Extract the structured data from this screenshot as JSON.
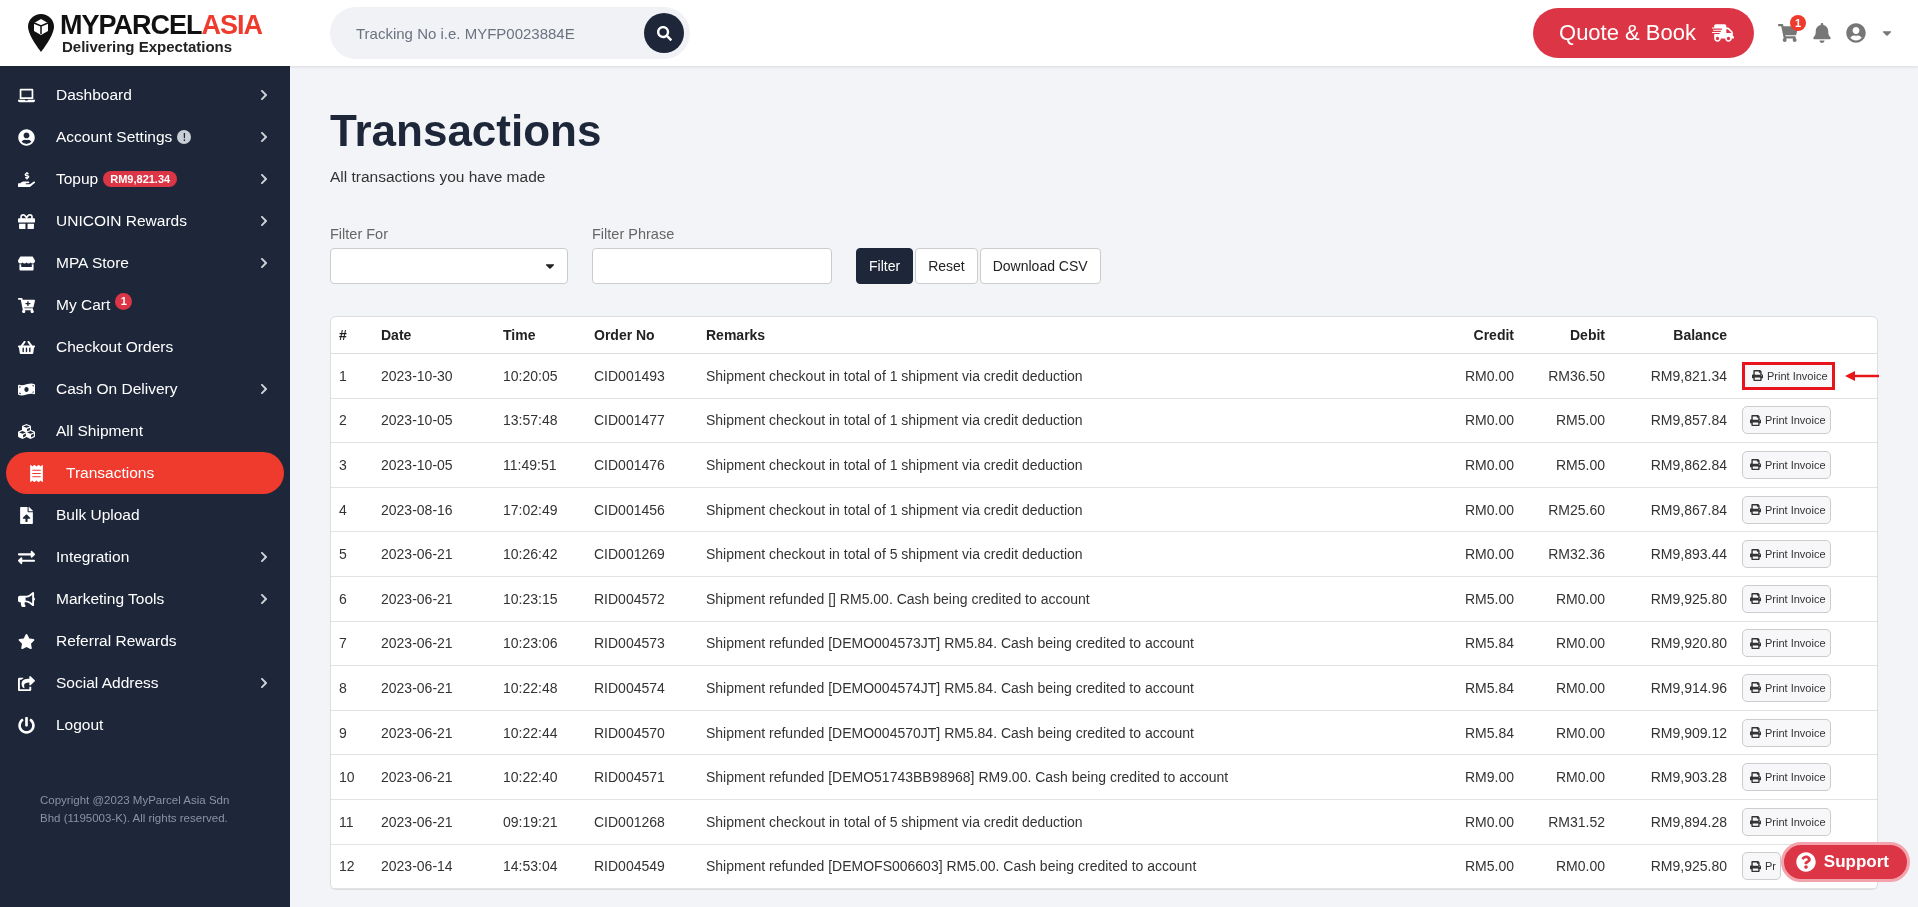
{
  "header": {
    "logo": {
      "brand": "MYPARCEL",
      "brand_accent": "ASIA",
      "tagline": "Delivering Expectations"
    },
    "search": {
      "placeholder": "Tracking No i.e. MYFP0023884E"
    },
    "quote_button": "Quote & Book",
    "cart_badge": "1"
  },
  "sidebar": {
    "items": [
      {
        "label": "Dashboard",
        "has_submenu": true,
        "selected": false
      },
      {
        "label": "Account Settings",
        "badge": {
          "kind": "info",
          "text": "!"
        },
        "has_submenu": true,
        "selected": false
      },
      {
        "label": "Topup",
        "badge": {
          "kind": "amount",
          "text": "RM9,821.34"
        },
        "has_submenu": true,
        "selected": false
      },
      {
        "label": "UNICOIN Rewards",
        "has_submenu": true,
        "selected": false
      },
      {
        "label": "MPA Store",
        "has_submenu": true,
        "selected": false
      },
      {
        "label": "My Cart",
        "badge": {
          "kind": "count",
          "text": "1"
        },
        "has_submenu": false,
        "selected": false
      },
      {
        "label": "Checkout Orders",
        "has_submenu": false,
        "selected": false
      },
      {
        "label": "Cash On Delivery",
        "has_submenu": true,
        "selected": false
      },
      {
        "label": "All Shipment",
        "has_submenu": false,
        "selected": false
      },
      {
        "label": "Transactions",
        "has_submenu": false,
        "selected": true
      },
      {
        "label": "Bulk Upload",
        "has_submenu": false,
        "selected": false
      },
      {
        "label": "Integration",
        "has_submenu": true,
        "selected": false
      },
      {
        "label": "Marketing Tools",
        "has_submenu": true,
        "selected": false
      },
      {
        "label": "Referral Rewards",
        "has_submenu": false,
        "selected": false
      },
      {
        "label": "Social Address",
        "has_submenu": true,
        "selected": false
      },
      {
        "label": "Logout",
        "has_submenu": false,
        "selected": false
      }
    ],
    "copyright": "Copyright @2023 MyParcel Asia Sdn Bhd (1195003-K). All rights reserved."
  },
  "page": {
    "title": "Transactions",
    "subtitle": "All transactions you have made"
  },
  "filters": {
    "filter_for": {
      "label": "Filter For"
    },
    "filter_phrase": {
      "label": "Filter Phrase"
    },
    "buttons": [
      {
        "label": "Filter",
        "kind": "primary"
      },
      {
        "label": "Reset",
        "kind": "default"
      },
      {
        "label": "Download CSV",
        "kind": "default"
      }
    ]
  },
  "table": {
    "columns": [
      "#",
      "Date",
      "Time",
      "Order No",
      "Remarks",
      "Credit",
      "Debit",
      "Balance"
    ],
    "rows": [
      {
        "no": "1",
        "date": "2023-10-30",
        "time": "10:20:05",
        "order": "CID001493",
        "remarks": "Shipment checkout in total of 1 shipment via credit deduction",
        "credit": "RM0.00",
        "debit": "RM36.50",
        "balance": "RM9,821.34",
        "action": "Print Invoice",
        "highlighted": true
      },
      {
        "no": "2",
        "date": "2023-10-05",
        "time": "13:57:48",
        "order": "CID001477",
        "remarks": "Shipment checkout in total of 1 shipment via credit deduction",
        "credit": "RM0.00",
        "debit": "RM5.00",
        "balance": "RM9,857.84",
        "action": "Print Invoice",
        "highlighted": false
      },
      {
        "no": "3",
        "date": "2023-10-05",
        "time": "11:49:51",
        "order": "CID001476",
        "remarks": "Shipment checkout in total of 1 shipment via credit deduction",
        "credit": "RM0.00",
        "debit": "RM5.00",
        "balance": "RM9,862.84",
        "action": "Print Invoice",
        "highlighted": false
      },
      {
        "no": "4",
        "date": "2023-08-16",
        "time": "17:02:49",
        "order": "CID001456",
        "remarks": "Shipment checkout in total of 1 shipment via credit deduction",
        "credit": "RM0.00",
        "debit": "RM25.60",
        "balance": "RM9,867.84",
        "action": "Print Invoice",
        "highlighted": false
      },
      {
        "no": "5",
        "date": "2023-06-21",
        "time": "10:26:42",
        "order": "CID001269",
        "remarks": "Shipment checkout in total of 5 shipment via credit deduction",
        "credit": "RM0.00",
        "debit": "RM32.36",
        "balance": "RM9,893.44",
        "action": "Print Invoice",
        "highlighted": false
      },
      {
        "no": "6",
        "date": "2023-06-21",
        "time": "10:23:15",
        "order": "RID004572",
        "remarks": "Shipment refunded [] RM5.00. Cash being credited to account",
        "credit": "RM5.00",
        "debit": "RM0.00",
        "balance": "RM9,925.80",
        "action": "Print Invoice",
        "highlighted": false
      },
      {
        "no": "7",
        "date": "2023-06-21",
        "time": "10:23:06",
        "order": "RID004573",
        "remarks": "Shipment refunded [DEMO004573JT] RM5.84. Cash being credited to account",
        "credit": "RM5.84",
        "debit": "RM0.00",
        "balance": "RM9,920.80",
        "action": "Print Invoice",
        "highlighted": false
      },
      {
        "no": "8",
        "date": "2023-06-21",
        "time": "10:22:48",
        "order": "RID004574",
        "remarks": "Shipment refunded [DEMO004574JT] RM5.84. Cash being credited to account",
        "credit": "RM5.84",
        "debit": "RM0.00",
        "balance": "RM9,914.96",
        "action": "Print Invoice",
        "highlighted": false
      },
      {
        "no": "9",
        "date": "2023-06-21",
        "time": "10:22:44",
        "order": "RID004570",
        "remarks": "Shipment refunded [DEMO004570JT] RM5.84. Cash being credited to account",
        "credit": "RM5.84",
        "debit": "RM0.00",
        "balance": "RM9,909.12",
        "action": "Print Invoice",
        "highlighted": false
      },
      {
        "no": "10",
        "date": "2023-06-21",
        "time": "10:22:40",
        "order": "RID004571",
        "remarks": "Shipment refunded [DEMO51743BB98968] RM9.00. Cash being credited to account",
        "credit": "RM9.00",
        "debit": "RM0.00",
        "balance": "RM9,903.28",
        "action": "Print Invoice",
        "highlighted": false
      },
      {
        "no": "11",
        "date": "2023-06-21",
        "time": "09:19:21",
        "order": "CID001268",
        "remarks": "Shipment checkout in total of 5 shipment via credit deduction",
        "credit": "RM0.00",
        "debit": "RM31.52",
        "balance": "RM9,894.28",
        "action": "Print Invoice",
        "highlighted": false
      },
      {
        "no": "12",
        "date": "2023-06-14",
        "time": "14:53:04",
        "order": "RID004549",
        "remarks": "Shipment refunded [DEMOFS006603] RM5.00. Cash being credited to account",
        "credit": "RM5.00",
        "debit": "RM0.00",
        "balance": "RM9,925.80",
        "action": "Pr",
        "highlighted": false
      }
    ]
  },
  "support_button": "Support"
}
